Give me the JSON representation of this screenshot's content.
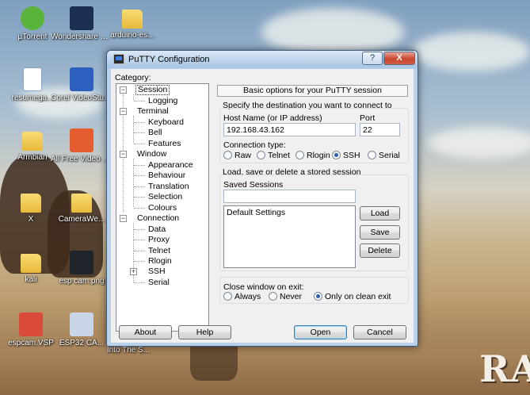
{
  "desktop": {
    "icons": [
      {
        "label": "µTorrent"
      },
      {
        "label": "Wondershare Filmora"
      },
      {
        "label": "arduino-es..."
      },
      {
        "label": "resumega..."
      },
      {
        "label": "Corel VideoStud..."
      },
      {
        "label": "Armbian"
      },
      {
        "label": "All Free Video C..."
      },
      {
        "label": "X"
      },
      {
        "label": "CameraWe..."
      },
      {
        "label": "kali"
      },
      {
        "label": "esp cam.png"
      },
      {
        "label": "espcam.VSP"
      },
      {
        "label": "ESP32 CA..."
      },
      {
        "label": "Into The S..."
      }
    ],
    "background_logo": "RA"
  },
  "window": {
    "title": "PuTTY Configuration",
    "help_btn": "?",
    "close_btn": "X"
  },
  "category": {
    "label": "Category:",
    "tree": [
      {
        "label": "Session",
        "level": 0,
        "expanded": true,
        "selected": true
      },
      {
        "label": "Logging",
        "level": 1
      },
      {
        "label": "Terminal",
        "level": 0,
        "expanded": true
      },
      {
        "label": "Keyboard",
        "level": 1
      },
      {
        "label": "Bell",
        "level": 1
      },
      {
        "label": "Features",
        "level": 1
      },
      {
        "label": "Window",
        "level": 0,
        "expanded": true
      },
      {
        "label": "Appearance",
        "level": 1
      },
      {
        "label": "Behaviour",
        "level": 1
      },
      {
        "label": "Translation",
        "level": 1
      },
      {
        "label": "Selection",
        "level": 1
      },
      {
        "label": "Colours",
        "level": 1
      },
      {
        "label": "Connection",
        "level": 0,
        "expanded": true
      },
      {
        "label": "Data",
        "level": 1
      },
      {
        "label": "Proxy",
        "level": 1
      },
      {
        "label": "Telnet",
        "level": 1
      },
      {
        "label": "Rlogin",
        "level": 1
      },
      {
        "label": "SSH",
        "level": 1,
        "expanded": false
      },
      {
        "label": "Serial",
        "level": 1
      }
    ]
  },
  "session": {
    "header": "Basic options for your PuTTY session",
    "destination_label": "Specify the destination you want to connect to",
    "host_label": "Host Name (or IP address)",
    "host_value": "192.168.43.162",
    "port_label": "Port",
    "port_value": "22",
    "conn_type_label": "Connection type:",
    "conn_types": [
      {
        "label": "Raw",
        "checked": false
      },
      {
        "label": "Telnet",
        "checked": false
      },
      {
        "label": "Rlogin",
        "checked": false
      },
      {
        "label": "SSH",
        "checked": true
      },
      {
        "label": "Serial",
        "checked": false
      }
    ],
    "load_save_label": "Load, save or delete a stored session",
    "saved_sessions_label": "Saved Sessions",
    "saved_sessions_value": "",
    "sessions_list": [
      "Default Settings"
    ],
    "load_btn": "Load",
    "save_btn": "Save",
    "delete_btn": "Delete",
    "close_label": "Close window on exit:",
    "close_options": [
      {
        "label": "Always",
        "checked": false
      },
      {
        "label": "Never",
        "checked": false
      },
      {
        "label": "Only on clean exit",
        "checked": true
      }
    ]
  },
  "footer": {
    "about_btn": "About",
    "help_btn": "Help",
    "open_btn": "Open",
    "cancel_btn": "Cancel"
  }
}
